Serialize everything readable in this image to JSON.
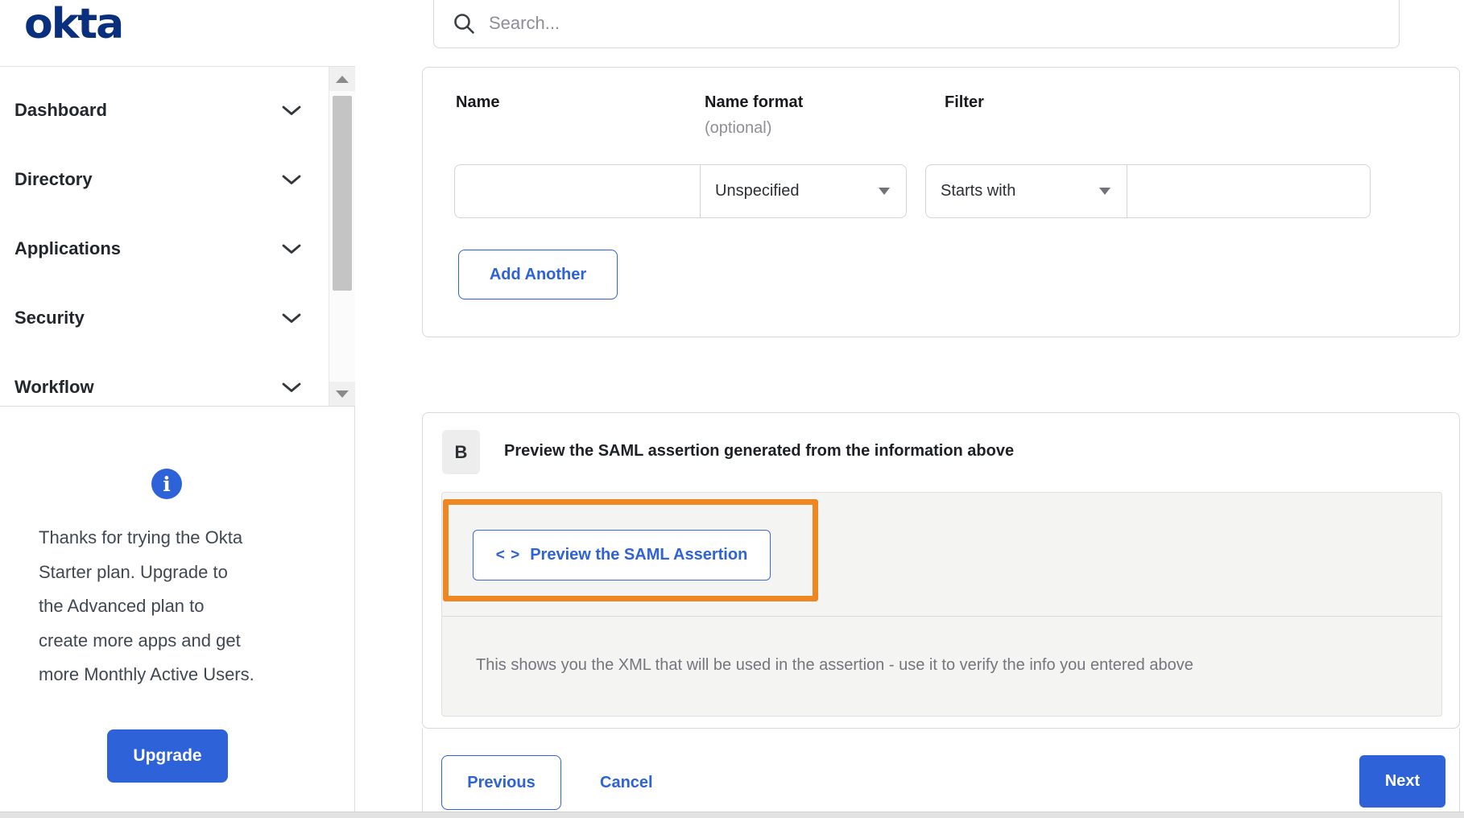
{
  "brand": {
    "logo_text": "okta"
  },
  "header": {
    "search_placeholder": "Search..."
  },
  "colors": {
    "primary_blue": "#2d62d8",
    "annotation_orange": "#ee8722",
    "logo_navy": "#0a2f7c"
  },
  "sidebar": {
    "items": [
      {
        "label": "Dashboard"
      },
      {
        "label": "Directory"
      },
      {
        "label": "Applications"
      },
      {
        "label": "Security"
      },
      {
        "label": "Workflow"
      }
    ],
    "upsell": {
      "info_icon_glyph": "i",
      "text_lines": [
        "Thanks for trying the Okta",
        "Starter plan. Upgrade to",
        "the Advanced plan to",
        "create more apps and get",
        "more Monthly Active Users."
      ],
      "upgrade_label": "Upgrade"
    }
  },
  "attribute_form": {
    "name_label": "Name",
    "name_format_label": "Name format",
    "name_format_optional": "(optional)",
    "filter_label": "Filter",
    "name_value": "",
    "name_format_value": "Unspecified",
    "filter_type_value": "Starts with",
    "filter_value": "",
    "add_another_label": "Add Another"
  },
  "preview_section": {
    "badge": "B",
    "heading": "Preview the SAML assertion generated from the information above",
    "code_icon": "< >",
    "preview_button_label": "Preview the SAML Assertion",
    "description": "This shows you the XML that will be used in the assertion - use it to verify the info you entered above"
  },
  "footer": {
    "previous_label": "Previous",
    "cancel_label": "Cancel",
    "next_label": "Next"
  }
}
